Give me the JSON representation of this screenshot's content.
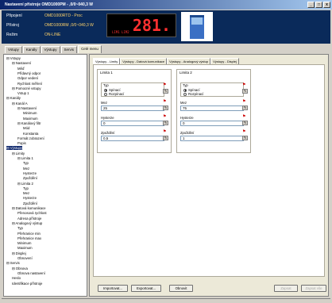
{
  "window": {
    "title": "Nastavení přístroje OMD1000PM - ,0/0~040,3 W",
    "btn_min": "_",
    "btn_max": "□",
    "btn_close": "x"
  },
  "header": {
    "rows": [
      {
        "label": "Připojení",
        "value": "OMD1000RTD - Proc"
      },
      {
        "label": "Přístroj",
        "value": "OMD1000RM ,0/0~040,3 W"
      },
      {
        "label": "Režim",
        "value": "ON-LINE"
      }
    ],
    "display_value": "281.",
    "display_unit": "LIM1   LIM2"
  },
  "main_tabs": [
    "Vstupy",
    "Kanály",
    "Výstupy",
    "Servis",
    "Celé menu"
  ],
  "tree": [
    {
      "t": "⊟ Vstupy",
      "d": 0
    },
    {
      "t": "⊟ Nastavení",
      "d": 1
    },
    {
      "t": "Měď",
      "d": 2
    },
    {
      "t": "Přídavný odpor",
      "d": 2
    },
    {
      "t": "Odpor vedení",
      "d": 2
    },
    {
      "t": "Rychlost měření",
      "d": 2
    },
    {
      "t": "⊟ Pomocné vstupy",
      "d": 1
    },
    {
      "t": "Vstup 1",
      "d": 2
    },
    {
      "t": "⊟ Kanály",
      "d": 0
    },
    {
      "t": "⊟ Kanál A",
      "d": 1
    },
    {
      "t": "⊟ Nastavení",
      "d": 2
    },
    {
      "t": "Minimum",
      "d": 3
    },
    {
      "t": "Maximum",
      "d": 3
    },
    {
      "t": "⊟ Kanálový filtr",
      "d": 2
    },
    {
      "t": "Mód",
      "d": 3
    },
    {
      "t": "Konstanta",
      "d": 3
    },
    {
      "t": "Formát zobrazení",
      "d": 2
    },
    {
      "t": "Popis",
      "d": 2
    },
    {
      "t": "⊟ Výstupy",
      "d": 0,
      "sel": true
    },
    {
      "t": "⊟ Limity",
      "d": 1
    },
    {
      "t": "⊟ Limita 1",
      "d": 2
    },
    {
      "t": "Typ",
      "d": 3
    },
    {
      "t": "Mez",
      "d": 3
    },
    {
      "t": "Hysterze",
      "d": 3
    },
    {
      "t": "Zpoždění",
      "d": 3
    },
    {
      "t": "⊟ Limita 2",
      "d": 2
    },
    {
      "t": "Typ",
      "d": 3
    },
    {
      "t": "Mez",
      "d": 3
    },
    {
      "t": "Hysterze",
      "d": 3
    },
    {
      "t": "Zpoždění",
      "d": 3
    },
    {
      "t": "⊟ Datová komunikace",
      "d": 1
    },
    {
      "t": "Přenosová rychlost",
      "d": 2
    },
    {
      "t": "Adresa přístroje",
      "d": 2
    },
    {
      "t": "⊟ Analogový výstup",
      "d": 1
    },
    {
      "t": "Typ",
      "d": 2
    },
    {
      "t": "Přehranice min",
      "d": 2
    },
    {
      "t": "Přehranice max",
      "d": 2
    },
    {
      "t": "Minimum",
      "d": 2
    },
    {
      "t": "Maximum",
      "d": 2
    },
    {
      "t": "⊟ Displej",
      "d": 1
    },
    {
      "t": "Obnovení",
      "d": 2
    },
    {
      "t": "⊟ Servis",
      "d": 0
    },
    {
      "t": "⊟ Obnova",
      "d": 1
    },
    {
      "t": "Obnova nastavení",
      "d": 2
    },
    {
      "t": "Heslo",
      "d": 1
    },
    {
      "t": "Identifikace přístroje",
      "d": 1
    }
  ],
  "sub_tabs": [
    "Výstupy - Limity",
    "Výstupy - Datová komunikace",
    "Výstupy - Analogový výstup",
    "Výstupy - Displej"
  ],
  "limits": [
    {
      "title": "Limita 1",
      "type_label": "Typ",
      "opt1": "Spínací",
      "opt2": "Rozpínací",
      "sel": 1,
      "mez_label": "Mez",
      "mez": "25",
      "hyst_label": "Hysterze",
      "hyst": "0",
      "delay_label": "Zpoždění",
      "delay": "0,5"
    },
    {
      "title": "Limita 2",
      "type_label": "Typ",
      "opt1": "Spínací",
      "opt2": "Rozpínací",
      "sel": 1,
      "mez_label": "Mez",
      "mez": "75",
      "hyst_label": "Hysterze",
      "hyst": "0",
      "delay_label": "Zpoždění",
      "delay": "1"
    }
  ],
  "buttons": {
    "import": "Importovat...",
    "export": "Exportovat...",
    "refresh": "Obnovit",
    "write": "Zapsat",
    "write_all": "Zapsat vše"
  }
}
